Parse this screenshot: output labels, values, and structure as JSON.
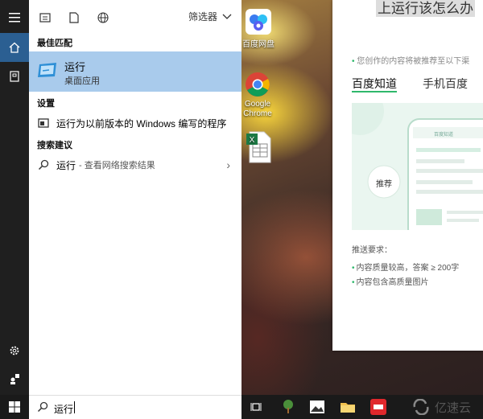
{
  "start_menu": {
    "top_icons": [
      "document-list-icon",
      "file-icon",
      "globe-icon"
    ],
    "filter_label": "筛选器",
    "best_match_heading": "最佳匹配",
    "best_match": {
      "title": "运行",
      "subtitle": "桌面应用"
    },
    "settings_heading": "设置",
    "settings_item": "运行为以前版本的 Windows 编写的程序",
    "suggestions_heading": "搜索建议",
    "suggestion": {
      "query": "运行",
      "hint": "- 查看网络搜索结果"
    }
  },
  "search_box": {
    "value": "运行"
  },
  "desktop_icons": [
    {
      "label": "百度网盘"
    },
    {
      "label": "Google Chrome"
    },
    {
      "label": ""
    }
  ],
  "web_page": {
    "title": "上运行该怎么办",
    "note": "您创作的内容将被推荐至以下渠",
    "tabs": [
      "百度知道",
      "手机百度"
    ],
    "illustration_tag": "推荐",
    "illustration_header": "百度知道",
    "requirements_heading": "推送要求：",
    "requirements": [
      "内容质量较高，答案 ≥ 200字",
      "内容包含高质量图片"
    ]
  },
  "watermark": "亿速云",
  "colors": {
    "accent": "#2b5f92",
    "best_match_bg": "#a9cbec",
    "green": "#2fb86b"
  }
}
